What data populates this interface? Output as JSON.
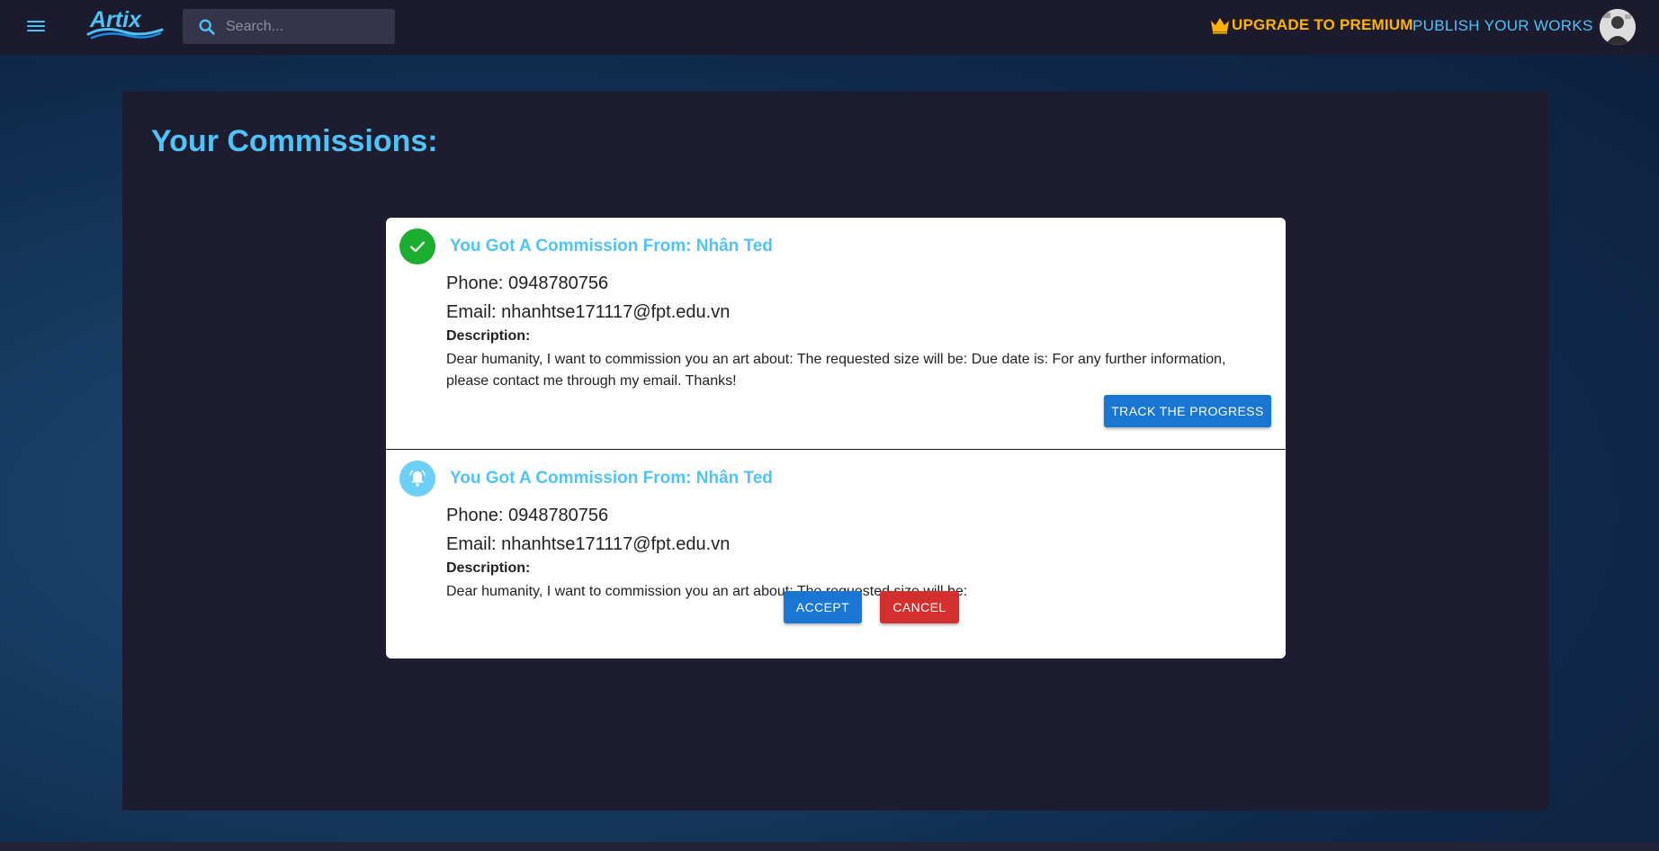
{
  "app": {
    "brand": "Artix"
  },
  "header": {
    "menu_icon": "hamburger-menu-icon",
    "search_icon": "search-icon",
    "search_placeholder": "Search...",
    "search_value": "",
    "premium_icon": "crown-icon",
    "premium_label": "UPGRADE TO PREMIUM",
    "publish_label": "PUBLISH YOUR WORKS",
    "avatar_icon": "user-avatar"
  },
  "page": {
    "title": "Your Commissions:"
  },
  "commissions": [
    {
      "status_icon": "check-circle-icon",
      "status_color": "#1aad2e",
      "heading": "You Got A Commission From: Nhân Ted",
      "phone": "Phone: 0948780756",
      "email": "Email: nhanhtse171117@fpt.edu.vn",
      "description_label": "Description:",
      "description": "Dear humanity, I want to commission you an art about: The requested size will be: Due date is: For any further information, please contact me through my email. Thanks!",
      "action_label": "TRACK THE PROGRESS"
    },
    {
      "status_icon": "bell-circle-icon",
      "status_color": "#6ccff6",
      "heading": "You Got A Commission From: Nhân Ted",
      "phone": "Phone: 0948780756",
      "email": "Email: nhanhtse171117@fpt.edu.vn",
      "description_label": "Description:",
      "description": "Dear humanity, I want to commission you an art about: The requested size will be:",
      "accept_label": "ACCEPT",
      "cancel_label": "CANCEL"
    }
  ],
  "colors": {
    "accent": "#4fc3f7",
    "premium": "#ffb300",
    "topbar": "#1b1b2d",
    "panel": "#1d1c30",
    "primary_button": "#1976d2",
    "danger_button": "#d32f2f"
  }
}
